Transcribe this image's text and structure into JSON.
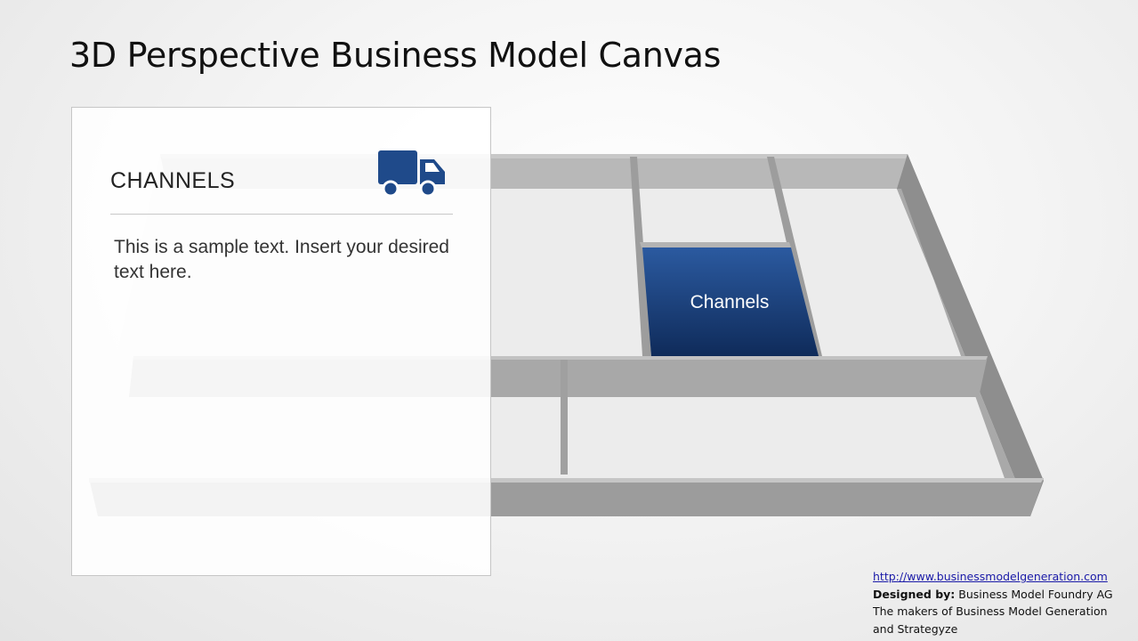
{
  "page": {
    "title": "3D Perspective Business Model Canvas"
  },
  "panel": {
    "heading": "CHANNELS",
    "icon": "truck-icon",
    "body": "This is a sample text. Insert your desired text here."
  },
  "canvas": {
    "highlight_label": "Channels",
    "highlight_color": "#1f4a8a"
  },
  "credits": {
    "url": "http://www.businessmodelgeneration.com",
    "designed_by_label": "Designed by:",
    "designed_by_value": " Business Model Foundry AG",
    "tagline": "The makers of Business Model Generation and Strategyze"
  }
}
